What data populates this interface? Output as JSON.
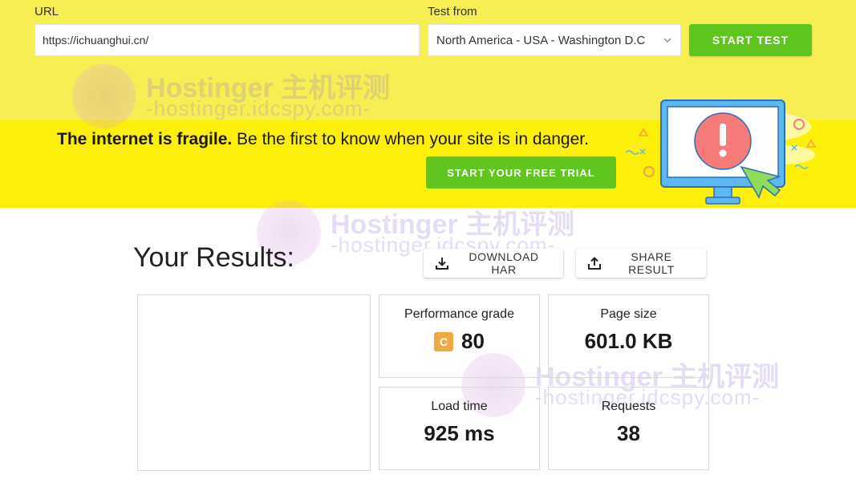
{
  "form": {
    "url_label": "URL",
    "url_value": "https://ichuanghui.cn/",
    "test_from_label": "Test from",
    "test_from_value": "North America - USA - Washington D.C",
    "start_button": "START TEST"
  },
  "promo": {
    "headline_bold": "The internet is fragile.",
    "headline_rest": " Be the first to know when your site is in danger.",
    "trial_button": "START YOUR FREE TRIAL"
  },
  "watermark": {
    "title": "Hostinger 主机评测",
    "subtitle": "-hostinger.idcspy.com-"
  },
  "results": {
    "title": "Your Results:",
    "download_button": "DOWNLOAD HAR",
    "share_button": "SHARE RESULT",
    "metrics": {
      "performance": {
        "label": "Performance grade",
        "grade": "C",
        "value": "80"
      },
      "page_size": {
        "label": "Page size",
        "value": "601.0 KB"
      },
      "load_time": {
        "label": "Load time",
        "value": "925 ms"
      },
      "requests": {
        "label": "Requests",
        "value": "38"
      }
    }
  },
  "colors": {
    "top_band": "#f6ee52",
    "promo_band": "#fcef0a",
    "button_green": "#5fc51f",
    "grade_c": "#f3a942"
  },
  "icons": {
    "select_arrow": "chevron-down-icon",
    "download": "download-icon",
    "share": "share-icon",
    "illustration": "monitor-alert-illustration"
  }
}
